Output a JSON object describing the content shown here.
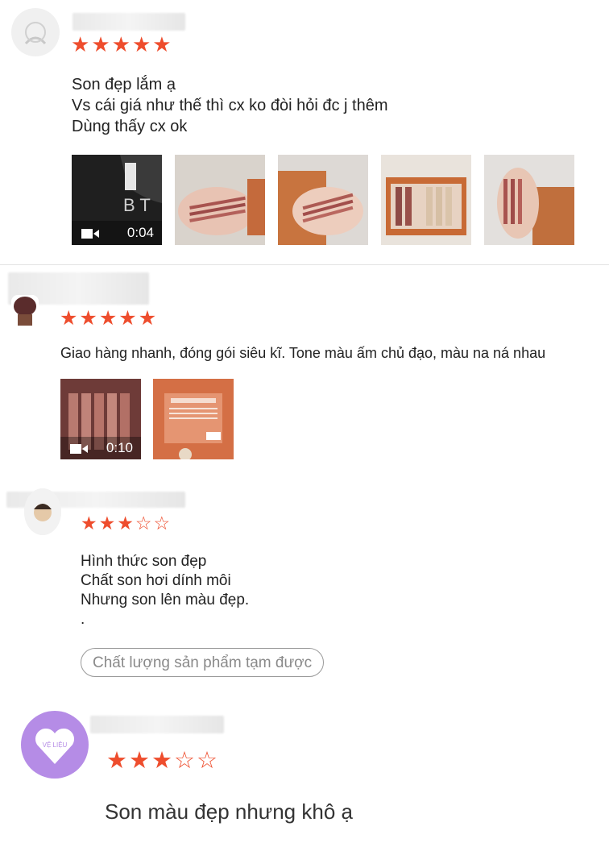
{
  "reviews": [
    {
      "rating": 5,
      "max_rating": 5,
      "lines": [
        "Son đẹp lắm ạ",
        "Vs cái giá như thế thì cx ko đòi hỏi đc j thêm",
        "Dùng thấy cx ok"
      ],
      "video_duration": "0:04"
    },
    {
      "rating": 5,
      "max_rating": 5,
      "lines": [
        "Giao hàng nhanh, đóng gói siêu kĩ. Tone màu ấm chủ đạo, màu na ná nhau"
      ],
      "video_duration": "0:10"
    },
    {
      "rating": 3,
      "max_rating": 5,
      "lines": [
        "Hình thức son đẹp",
        "Chất son hơi dính môi",
        "Nhưng son lên màu đẹp.",
        "."
      ],
      "tag": "Chất lượng sản phẩm tạm được"
    },
    {
      "rating": 3,
      "max_rating": 5,
      "lines": [
        "Son màu đẹp nhưng khô ạ"
      ],
      "avatar_text": "VỆ LIỆU"
    }
  ],
  "colors": {
    "star": "#ee4d2d",
    "avatar_purple": "#b58ce6"
  },
  "icons": {
    "video": "video-camera-icon",
    "star": "star-icon",
    "heart": "heart-icon"
  }
}
